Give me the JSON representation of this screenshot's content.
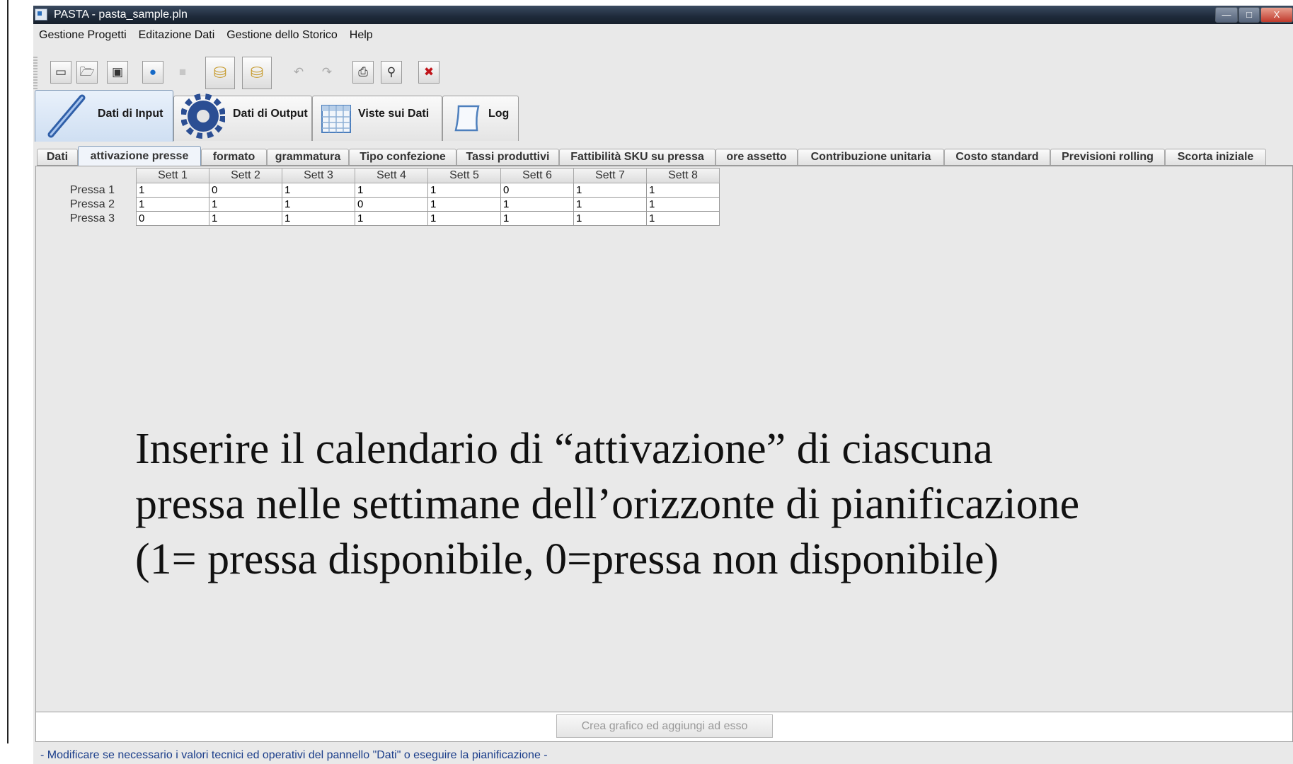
{
  "window": {
    "title": "PASTA - pasta_sample.pln",
    "controls": {
      "minimize": "—",
      "maximize": "□",
      "close": "X"
    }
  },
  "menu": [
    "Gestione Progetti",
    "Editazione Dati",
    "Gestione dello Storico",
    "Help"
  ],
  "toolbar": [
    {
      "name": "new-project-icon",
      "glyph": "▭"
    },
    {
      "name": "open-folder-icon",
      "glyph": "🗁"
    },
    {
      "name": "save-icon",
      "glyph": "▣"
    },
    {
      "name": "run-icon",
      "glyph": "●"
    },
    {
      "name": "stop-icon",
      "glyph": "■"
    },
    {
      "name": "import-db-icon",
      "glyph": "⛁"
    },
    {
      "name": "export-db-icon",
      "glyph": "⛁"
    },
    {
      "name": "undo-icon",
      "glyph": "↶"
    },
    {
      "name": "redo-icon",
      "glyph": "↷"
    },
    {
      "name": "print-preview-icon",
      "glyph": "⎙"
    },
    {
      "name": "zoom-icon",
      "glyph": "⚲"
    },
    {
      "name": "close-x-icon",
      "glyph": "✖"
    }
  ],
  "main_tabs": [
    "Dati di Input",
    "Dati di Output",
    "Viste sui Dati",
    "Log"
  ],
  "sub_tabs": [
    "Dati",
    "attivazione presse",
    "formato",
    "grammatura",
    "Tipo confezione",
    "Tassi produttivi",
    "Fattibilità SKU su pressa",
    "ore assetto",
    "Contribuzione unitaria",
    "Costo standard",
    "Previsioni rolling",
    "Scorta iniziale"
  ],
  "active_sub_tab": 1,
  "table": {
    "columns": [
      "Sett 1",
      "Sett 2",
      "Sett 3",
      "Sett 4",
      "Sett 5",
      "Sett 6",
      "Sett 7",
      "Sett 8"
    ],
    "rows": [
      {
        "label": "Pressa 1",
        "values": [
          "1",
          "0",
          "1",
          "1",
          "1",
          "0",
          "1",
          "1"
        ]
      },
      {
        "label": "Pressa 2",
        "values": [
          "1",
          "1",
          "1",
          "0",
          "1",
          "1",
          "1",
          "1"
        ]
      },
      {
        "label": "Pressa 3",
        "values": [
          "0",
          "1",
          "1",
          "1",
          "1",
          "1",
          "1",
          "1"
        ]
      }
    ]
  },
  "note": {
    "line1": "Inserire il calendario di “attivazione” di ciascuna",
    "line2": "pressa nelle settimane dell’orizzonte di pianificazione",
    "line3": "(1= pressa disponibile, 0=pressa non disponibile)"
  },
  "chart_button": "Crea grafico ed aggiungi ad esso",
  "status": "- Modificare se necessario i valori tecnici ed operativi del pannello \"Dati\" o eseguire la pianificazione -"
}
